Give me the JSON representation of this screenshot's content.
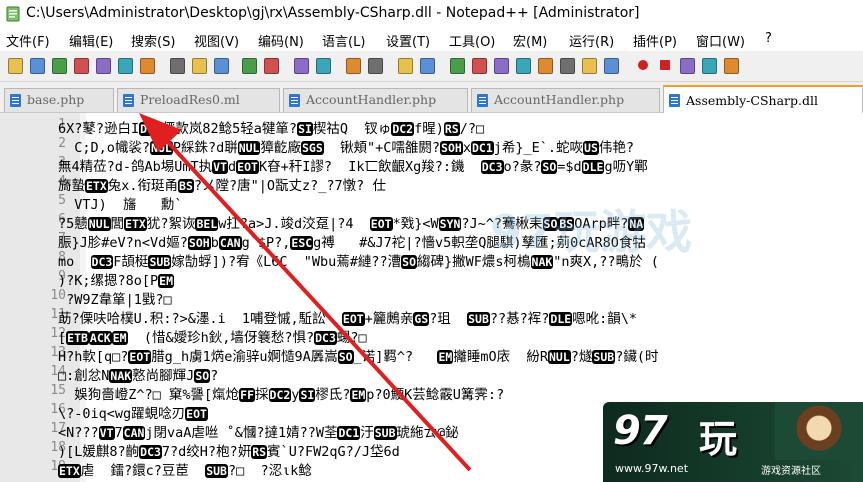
{
  "window": {
    "title": "C:\\Users\\Administrator\\Desktop\\gj\\rx\\Assembly-CSharp.dll - Notepad++ [Administrator]"
  },
  "menu": [
    "文件(F)",
    "编辑(E)",
    "搜索(S)",
    "视图(V)",
    "编码(N)",
    "语言(L)",
    "设置(T)",
    "工具(O)",
    "宏(M)",
    "运行(R)",
    "插件(P)",
    "窗口(W)",
    "?"
  ],
  "toolbar": {
    "icons": [
      "new-file-icon",
      "open-file-icon",
      "save-icon",
      "save-all-icon",
      "close-icon",
      "close-all-icon",
      "print-icon",
      "cut-icon",
      "copy-icon",
      "paste-icon",
      "undo-icon",
      "redo-icon",
      "find-icon",
      "replace-icon",
      "zoom-in-icon",
      "zoom-out-icon",
      "sync-vertical-icon",
      "sync-horizontal-icon",
      "word-wrap-icon",
      "show-all-chars-icon",
      "indent-guide-icon",
      "lang-define-icon",
      "doc-map-icon",
      "function-list-icon",
      "folder-workspace-icon",
      "monitor-icon",
      "record-macro-icon",
      "stop-record-icon",
      "play-macro-icon",
      "run-macro-multiple-icon",
      "save-macro-icon"
    ]
  },
  "tabs": [
    {
      "label": "base.php"
    },
    {
      "label": "PreloadRes0.ml"
    },
    {
      "label": "AccountHandler.php"
    },
    {
      "label": "AccountHandler.php"
    },
    {
      "label": "Assembly-CSharp.dll"
    }
  ],
  "lines": [
    {
      "n": "1",
      "segs": [
        {
          "t": "6X?鼕?逊白I"
        },
        {
          "k": "DC2"
        },
        {
          "t": "俨款岚82鲶5轻a犍箪?"
        },
        {
          "k": "SI"
        },
        {
          "t": "楔祜Q  钗ゅ"
        },
        {
          "k": "DC2"
        },
        {
          "t": "f暒)"
        },
        {
          "k": "RS"
        },
        {
          "t": "/?□"
        }
      ]
    },
    {
      "n": "2",
      "segs": [
        {
          "t": "  C;D,o幟裟?"
        },
        {
          "k": "NUL"
        },
        {
          "t": "P綵銖?d聠"
        },
        {
          "k": "NUL"
        },
        {
          "t": "獐齕廠"
        },
        {
          "k": "SGS"
        },
        {
          "t": "  锹頬\"+C嚅雒閼?"
        },
        {
          "k": "SOH"
        },
        {
          "t": "x"
        },
        {
          "k": "DC1"
        },
        {
          "t": "j希}_E`.蛇咴"
        },
        {
          "k": "US"
        },
        {
          "t": "伟艳?"
        }
      ]
    },
    {
      "n": "3",
      "segs": [
        {
          "t": "無4精莅?d-鸽Ab埸UmT执"
        },
        {
          "k": "VT"
        },
        {
          "t": "d"
        },
        {
          "k": "EOT"
        },
        {
          "t": "K昚+秆I謬?  Ik匸飲齦Xg羧?:鐖  "
        },
        {
          "k": "DC3"
        },
        {
          "t": "o?彖?"
        },
        {
          "k": "SO"
        },
        {
          "t": "=$d"
        },
        {
          "k": "DLE"
        },
        {
          "t": "g呖Y鄲"
        }
      ]
    },
    {
      "n": "4",
      "segs": [
        {
          "t": "旖蟄"
        },
        {
          "k": "ETX"
        },
        {
          "t": "兔x.衔珽甬"
        },
        {
          "k": "BS"
        },
        {
          "t": "?メ隚?唐\"|O翫丈z?_?7憞? 仕"
        }
      ]
    },
    {
      "n": "5",
      "segs": [
        {
          "t": "  VTJ)  旛   勳`"
        }
      ]
    },
    {
      "n": "6",
      "segs": [
        {
          "t": "?5戆"
        },
        {
          "k": "NUL"
        },
        {
          "t": "閭"
        },
        {
          "k": "ETX"
        },
        {
          "t": "犹?絮诙"
        },
        {
          "k": "BEL"
        },
        {
          "t": "w扛?a>J.竣d洨趸|?4  "
        },
        {
          "k": "EOT"
        },
        {
          "t": "*戣}<W"
        },
        {
          "k": "SYN"
        },
        {
          "t": "?J~^?鶱楸耒"
        },
        {
          "k": "SO"
        },
        {
          "k": "BS"
        },
        {
          "t": "OArp畔?"
        },
        {
          "k": "NA"
        }
      ]
    },
    {
      "n": "7",
      "segs": [
        {
          "t": "脤}J胗#eV?n<Vd嫗?"
        },
        {
          "k": "SOH"
        },
        {
          "t": "b"
        },
        {
          "k": "CAN"
        },
        {
          "t": "g`$P?,"
        },
        {
          "k": "ESC"
        },
        {
          "t": "g禣   #&J7袉|?懎v5軹垄Q腿騏)孳匯;莂0cAR8O食牯"
        }
      ]
    },
    {
      "n": "8",
      "segs": [
        {
          "t": "mo  "
        },
        {
          "k": "DC3"
        },
        {
          "t": "F頡梃"
        },
        {
          "k": "SUB"
        },
        {
          "t": "嫁勂蜉])?宥《L6C  \"Wbu蔫#縺??漕"
        },
        {
          "k": "SO"
        },
        {
          "t": "縐碑}撇WF燶s柯樢"
        },
        {
          "k": "NAK"
        },
        {
          "t": "\"n爽X,??鴫於 ("
        }
      ]
    },
    {
      "n": "9",
      "segs": [
        {
          "t": ")?K;缧摁?8o[P"
        },
        {
          "k": "EM"
        }
      ]
    },
    {
      "n": "10",
      "segs": [
        {
          "t": " ?W9Z韋箪|1戥?□"
        }
      ]
    },
    {
      "n": "11",
      "segs": [
        {
          "t": "莇?傈呋哈樸U.积:?>&濹.i  1哺登慽,駈訟  "
        },
        {
          "k": "EOT"
        },
        {
          "t": "+籭鶊亲"
        },
        {
          "k": "GS"
        },
        {
          "t": "?珇  "
        },
        {
          "k": "SUB"
        },
        {
          "t": "??惎?裈?"
        },
        {
          "k": "DLE"
        },
        {
          "t": "嗯吪:韻\\*"
        }
      ]
    },
    {
      "n": "12",
      "segs": [
        {
          "t": "["
        },
        {
          "k": "ETB"
        },
        {
          "k": "ACK"
        },
        {
          "k": "EM"
        },
        {
          "t": "  (惜&嬡珍h鈥,墙伢簔愁?惧?"
        },
        {
          "k": "DC3"
        },
        {
          "t": "蝪?□"
        }
      ]
    },
    {
      "n": "13",
      "segs": [
        {
          "t": "H?h軟[q□?"
        },
        {
          "k": "EOT"
        },
        {
          "t": "腊g_h虜1焫e渝骍u婀慥9A羼嵩"
        },
        {
          "k": "SO"
        },
        {
          "t": "_诺]羁^?   "
        },
        {
          "k": "EM"
        },
        {
          "t": "攡睡mO庡  紛R"
        },
        {
          "k": "NUL"
        },
        {
          "t": "?燧"
        },
        {
          "k": "SUB"
        },
        {
          "t": "?鑶(时"
        }
      ]
    },
    {
      "n": "14",
      "segs": [
        {
          "t": "□:創忿N"
        },
        {
          "k": "NAK"
        },
        {
          "t": "憝尚腳輝J"
        },
        {
          "k": "SO"
        },
        {
          "t": "?"
        }
      ]
    },
    {
      "n": "15",
      "segs": [
        {
          "t": "  娛狗嗇嶝Z^?□ 窠%謽[熂炝"
        },
        {
          "k": "FF"
        },
        {
          "t": "採"
        },
        {
          "k": "DC2"
        },
        {
          "t": "y"
        },
        {
          "k": "SI"
        },
        {
          "t": "樛氐?"
        },
        {
          "k": "EM"
        },
        {
          "t": "p?0鯁K芸鲶霰U篝霁:?"
        }
      ]
    },
    {
      "n": "16",
      "segs": [
        {
          "t": "\\?-0iq<wg躍蜆唸刃"
        },
        {
          "k": "EOT"
        }
      ]
    },
    {
      "n": "17",
      "segs": [
        {
          "t": "<N???"
        },
        {
          "k": "VT"
        },
        {
          "t": "7"
        },
        {
          "k": "CAN"
        },
        {
          "t": "j閉vaA虐咝 ˚&慖?撻1婧??W荃"
        },
        {
          "k": "DC1"
        },
        {
          "t": "汙"
        },
        {
          "k": "SUB"
        },
        {
          "t": "琥絁ㄊ@鉍"
        }
      ]
    },
    {
      "n": "18",
      "segs": [
        {
          "t": ")[L媛麒8?齣"
        },
        {
          "k": "DC3"
        },
        {
          "t": "7?d绞H?枹?姸"
        },
        {
          "k": "RS"
        },
        {
          "t": "賓`U?FW2qG?/J垈6d"
        }
      ]
    },
    {
      "n": "19",
      "segs": [
        {
          "k": "ETX"
        },
        {
          "t": "虐  鐳?鐶c?豆茞  "
        },
        {
          "k": "SUB"
        },
        {
          "t": "?□  ?涊ιk鲶"
        }
      ]
    }
  ],
  "watermark": "97玩游戏",
  "ad": {
    "logo": "97",
    "logo_text": "玩",
    "url": "www.97w.net",
    "slogan": "游戏资源社区"
  },
  "colors": {
    "arrow": "#e02020",
    "active_tab_accent": "#f0a020",
    "control_char_bg": "#000000"
  }
}
